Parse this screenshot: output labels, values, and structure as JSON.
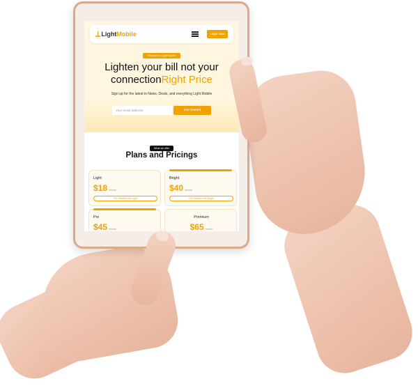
{
  "navbar": {
    "logo_text_1": "Light",
    "logo_text_2": "Mobile",
    "login_label": "Login Now"
  },
  "hero": {
    "badge": "Welcome to Light Mobile",
    "title_line1": "Lighten your bill not your",
    "title_line2": "connection",
    "title_accent": "Right Price",
    "subtitle": "Sign up for the latest in News, Deals, and everything Light Mobile",
    "email_placeholder": "Your email address",
    "cta_label": "Get Started"
  },
  "plans_section": {
    "badge": "What we offer",
    "title": "Plans and Pricings",
    "plans": [
      {
        "name": "Light",
        "price": "$18",
        "period": "/month",
        "button": "Get Started with Light"
      },
      {
        "name": "Bright",
        "price": "$40",
        "period": "/month",
        "button": "Get Started with Bright"
      },
      {
        "name": "Pro",
        "price": "$45",
        "period": "/month"
      },
      {
        "name": "Premium",
        "price": "$65",
        "period": "/month"
      }
    ]
  },
  "colors": {
    "accent": "#f0a200",
    "hero_bg": "#fff6df"
  }
}
